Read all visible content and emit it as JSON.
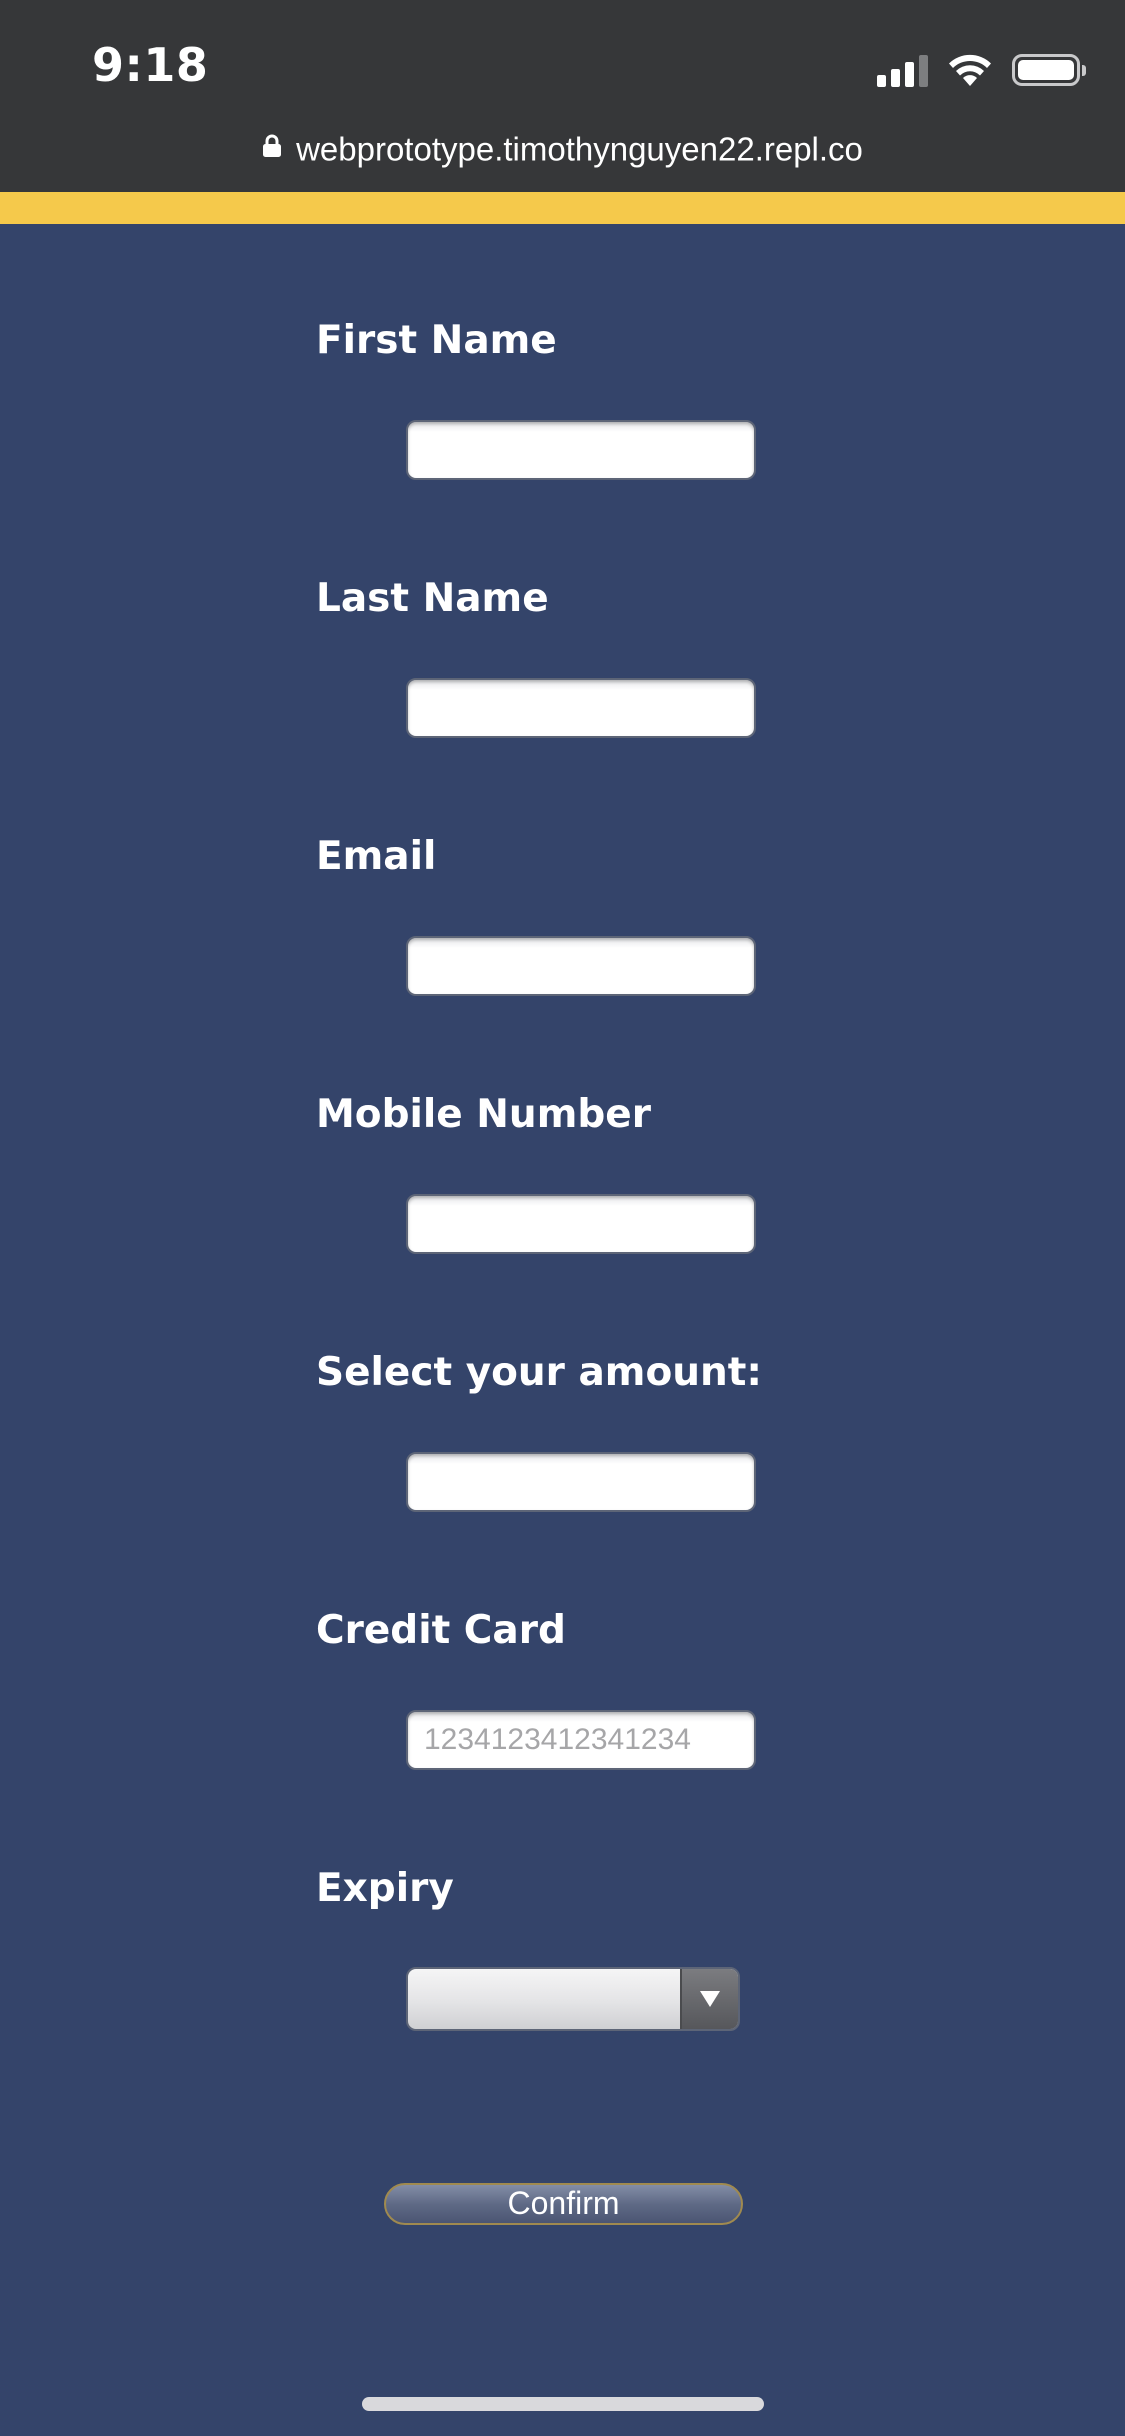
{
  "status_bar": {
    "time": "9:18",
    "icons": [
      "cellular-signal-icon",
      "wifi-icon",
      "battery-icon"
    ]
  },
  "browser": {
    "url": "webprototype.timothynguyen22.repl.co",
    "secure_icon": "lock-icon"
  },
  "colors": {
    "background": "#34446a",
    "status_bar": "#363739",
    "accent_stripe": "#f5c94b"
  },
  "form": {
    "first_name": {
      "label": "First Name",
      "value": "",
      "placeholder": ""
    },
    "last_name": {
      "label": "Last Name",
      "value": "",
      "placeholder": ""
    },
    "email": {
      "label": "Email",
      "value": "",
      "placeholder": ""
    },
    "mobile": {
      "label": "Mobile Number",
      "value": "",
      "placeholder": ""
    },
    "amount": {
      "label": "Select your amount:",
      "value": "",
      "placeholder": ""
    },
    "credit_card": {
      "label": "Credit Card",
      "value": "",
      "placeholder": "1234123412341234"
    },
    "expiry": {
      "label": "Expiry",
      "selected": "",
      "icon": "dropdown-arrow-icon"
    },
    "confirm_label": "Confirm"
  }
}
